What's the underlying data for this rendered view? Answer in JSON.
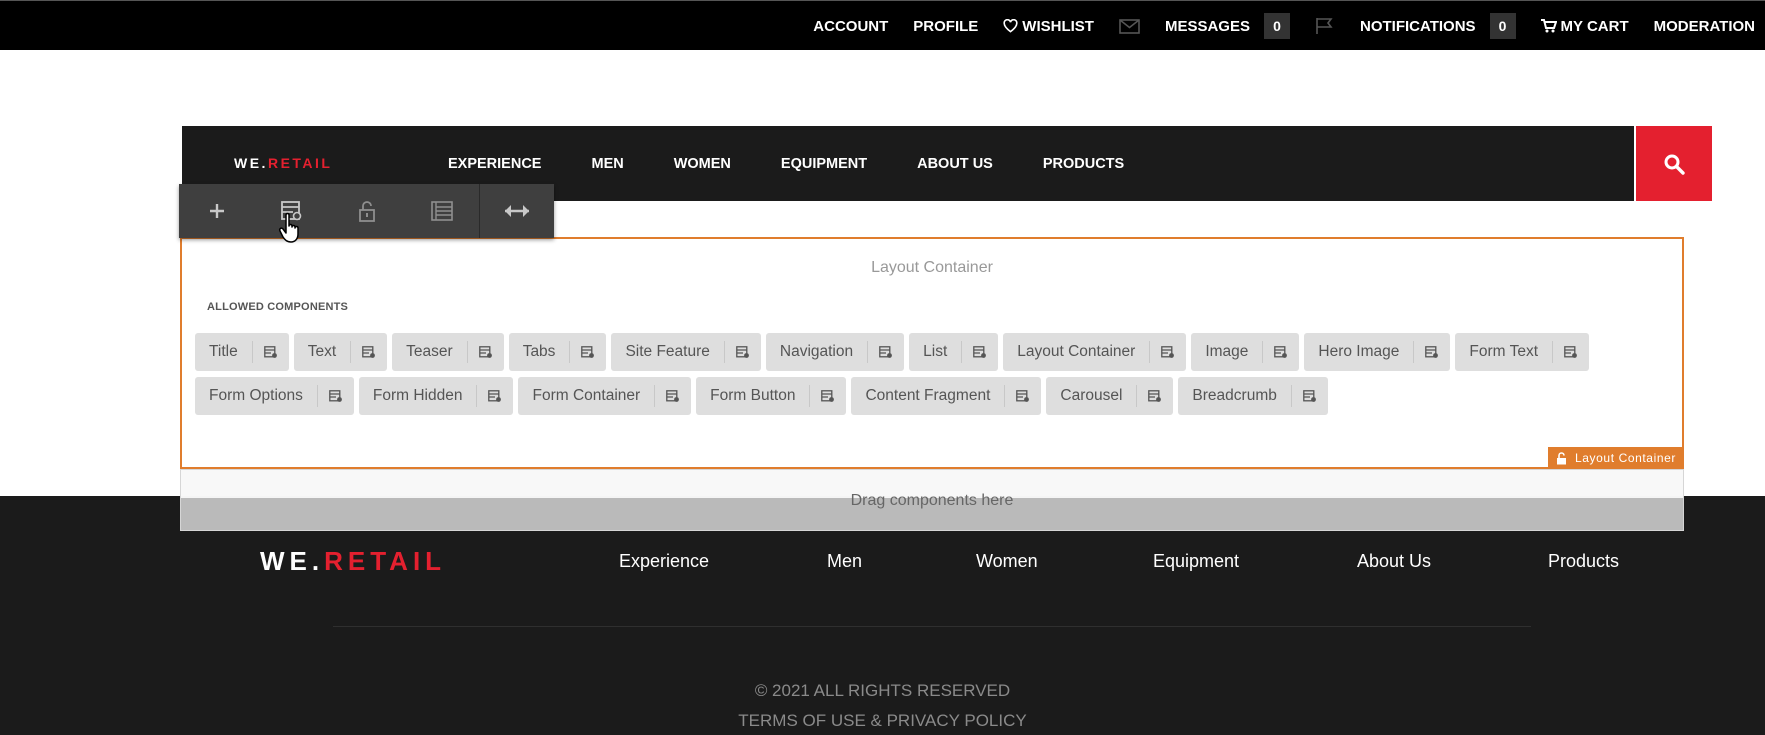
{
  "topbar": {
    "account": "ACCOUNT",
    "profile": "PROFILE",
    "wishlist": "WISHLIST",
    "messages": "MESSAGES",
    "messages_count": "0",
    "notifications": "NOTIFICATIONS",
    "notifications_count": "0",
    "cart": "MY CART",
    "moderation": "MODERATION"
  },
  "header": {
    "brand_we": "WE.",
    "brand_retail": "RETAIL",
    "nav": [
      "EXPERIENCE",
      "MEN",
      "WOMEN",
      "EQUIPMENT",
      "ABOUT US",
      "PRODUCTS"
    ]
  },
  "editor_toolbar": {
    "icons": [
      "plus-icon",
      "policy-icon",
      "unlock-icon",
      "properties-icon",
      "resize-icon"
    ]
  },
  "layout_container": {
    "title": "Layout Container",
    "allowed_label": "ALLOWED COMPONENTS",
    "components_row1": [
      "Title",
      "Text",
      "Teaser",
      "Tabs",
      "Site Feature",
      "Navigation",
      "List",
      "Layout Container",
      "Image",
      "Hero Image",
      "Form Text"
    ],
    "components_row2": [
      "Form Options",
      "Form Hidden",
      "Form Container",
      "Form Button",
      "Content Fragment",
      "Carousel",
      "Breadcrumb"
    ],
    "tag": "Layout Container"
  },
  "dropzone": {
    "text": "Drag components here"
  },
  "footer": {
    "brand_we": "WE.",
    "brand_retail": "RETAIL",
    "links": [
      "Experience",
      "Men",
      "Women",
      "Equipment",
      "About Us",
      "Products"
    ],
    "copyright": "© 2021 ALL RIGHTS RESERVED",
    "legal": "TERMS OF USE & PRIVACY POLICY"
  },
  "colors": {
    "accent_red": "#e4202f",
    "editor_orange": "#e07d2d",
    "dark": "#1b1b1b"
  }
}
